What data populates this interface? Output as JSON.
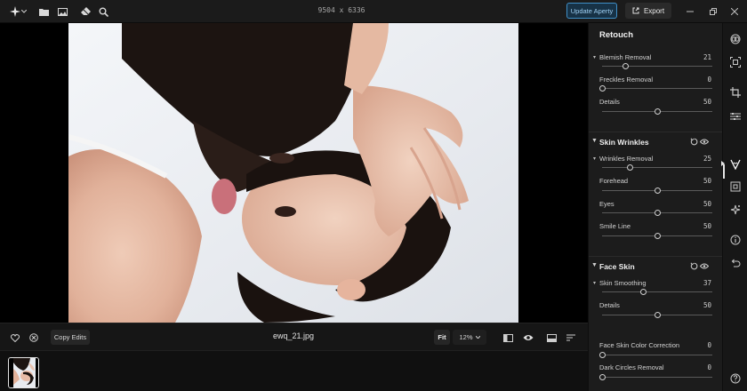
{
  "topbar": {
    "dimensions": "9504 x 6336",
    "update_label": "Update Aperty",
    "export_label": "Export",
    "icons": [
      "sparkle-logo-icon",
      "chevron-down-icon",
      "folder-icon",
      "image-icon",
      "eraser-icon",
      "magnifier-icon"
    ]
  },
  "canvas": {
    "filename": "ewq_21.jpg"
  },
  "bottombar": {
    "copy_edits_label": "Copy Edits",
    "fit_label": "Fit",
    "zoom_label": "12%"
  },
  "panel": {
    "title": "Retouch",
    "blemish": {
      "label": "Blemish Removal",
      "value": "21",
      "fraction": 0.21
    },
    "freckles": {
      "label": "Freckles Removal",
      "value": "0",
      "fraction": 0.0
    },
    "details": {
      "label": "Details",
      "value": "50",
      "fraction": 0.5
    },
    "skin_wrinkles": {
      "title": "Skin Wrinkles",
      "wrinkles": {
        "label": "Wrinkles Removal",
        "value": "25",
        "fraction": 0.25
      },
      "forehead": {
        "label": "Forehead",
        "value": "50",
        "fraction": 0.5
      },
      "eyes": {
        "label": "Eyes",
        "value": "50",
        "fraction": 0.5
      },
      "smile": {
        "label": "Smile Line",
        "value": "50",
        "fraction": 0.5
      }
    },
    "face_skin": {
      "title": "Face Skin",
      "smoothing": {
        "label": "Skin Smoothing",
        "value": "37",
        "fraction": 0.37
      },
      "details": {
        "label": "Details",
        "value": "50",
        "fraction": 0.5
      },
      "color_correction": {
        "label": "Face Skin Color Correction",
        "value": "0",
        "fraction": 0.0
      },
      "dark_circles": {
        "label": "Dark Circles Removal",
        "value": "0",
        "fraction": 0.0
      }
    }
  },
  "colors": {
    "accent": "#3f8fc7",
    "panel_bg": "#1c1c1c",
    "app_bg": "#121212"
  }
}
